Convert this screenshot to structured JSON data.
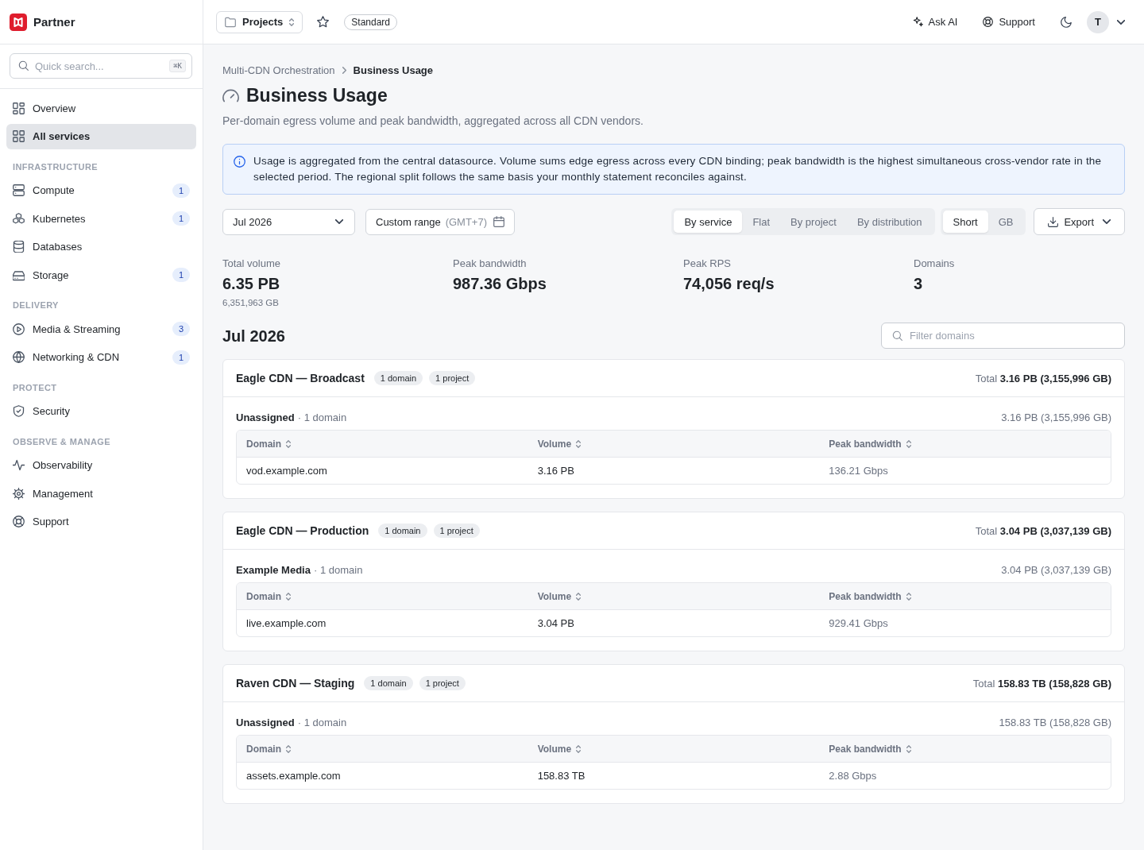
{
  "sidebar": {
    "brand": "Partner",
    "search": {
      "placeholder": "Quick search...",
      "shortcut": "⌘K"
    },
    "nav": [
      {
        "items": [
          {
            "label": "Overview",
            "selected": false
          },
          {
            "label": "All services",
            "selected": true
          }
        ]
      },
      {
        "title": "INFRASTRUCTURE",
        "items": [
          {
            "label": "Compute",
            "badge": "1",
            "selected": false
          },
          {
            "label": "Kubernetes",
            "badge": "1",
            "selected": false
          },
          {
            "label": "Databases",
            "selected": false
          },
          {
            "label": "Storage",
            "badge": "1",
            "selected": false
          }
        ]
      },
      {
        "title": "DELIVERY",
        "items": [
          {
            "label": "Media & Streaming",
            "badge": "3",
            "selected": false
          },
          {
            "label": "Networking & CDN",
            "badge": "1",
            "selected": false
          }
        ]
      },
      {
        "title": "PROTECT",
        "items": [
          {
            "label": "Security",
            "selected": false
          }
        ]
      },
      {
        "title": "OBSERVE & MANAGE",
        "items": [
          {
            "label": "Observability",
            "selected": false
          },
          {
            "label": "Management",
            "selected": false
          },
          {
            "label": "Support",
            "selected": false
          }
        ]
      }
    ]
  },
  "topbar": {
    "projects": "Projects",
    "plan": "Standard",
    "actions": [
      "Ask AI",
      "Support"
    ],
    "avatar": "T"
  },
  "breadcrumb": [
    "Multi-CDN Orchestration",
    "Business Usage"
  ],
  "title": "Business Usage",
  "subtitle": "Per-domain egress volume and peak bandwidth, aggregated across all CDN vendors.",
  "notice": "Usage is aggregated from the central datasource. Volume sums edge egress across every CDN binding; peak bandwidth is the highest simultaneous cross-vendor rate in the selected period. The regional split follows the same basis your monthly statement reconciles against.",
  "filters": {
    "month": "Jul 2026",
    "range": {
      "label": "Custom range",
      "timezone": "(GMT+7)"
    },
    "views": [
      {
        "label": "By service",
        "selected": true
      },
      {
        "label": "Flat",
        "selected": false
      },
      {
        "label": "By project",
        "selected": false
      },
      {
        "label": "By distribution",
        "selected": false
      }
    ],
    "units": [
      {
        "label": "Short",
        "selected": true
      },
      {
        "label": "GB",
        "selected": false
      }
    ],
    "export": "Export"
  },
  "stats": [
    {
      "label": "Total volume",
      "value": "6.35 PB",
      "sub": "6,351,963 GB"
    },
    {
      "label": "Peak bandwidth",
      "value": "987.36 Gbps"
    },
    {
      "label": "Peak RPS",
      "value": "74,056 req/s"
    },
    {
      "label": "Domains",
      "value": "3"
    }
  ],
  "period": "Jul 2026",
  "domain_filter": {
    "placeholder": "Filter domains"
  },
  "groups": [
    {
      "name": "Eagle CDN — Broadcast",
      "tags": [
        "1 domain",
        "1 project"
      ],
      "total": "Total **3.16 PB (3,155,996 GB)**",
      "projects": [
        {
          "name": "Unassigned",
          "count": "· 1 domain",
          "total": "3.16 PB (3,155,996 GB)",
          "columns": [
            "Domain",
            "Volume",
            "Peak bandwidth"
          ],
          "rows": [
            {
              "domain": "vod.example.com",
              "volume": "3.16 PB",
              "peak": "136.21 Gbps"
            }
          ]
        }
      ]
    },
    {
      "name": "Eagle CDN — Production",
      "tags": [
        "1 domain",
        "1 project"
      ],
      "total": "Total **3.04 PB (3,037,139 GB)**",
      "projects": [
        {
          "name": "Example Media",
          "count": "· 1 domain",
          "total": "3.04 PB (3,037,139 GB)",
          "columns": [
            "Domain",
            "Volume",
            "Peak bandwidth"
          ],
          "rows": [
            {
              "domain": "live.example.com",
              "volume": "3.04 PB",
              "peak": "929.41 Gbps"
            }
          ]
        }
      ]
    },
    {
      "name": "Raven CDN — Staging",
      "tags": [
        "1 domain",
        "1 project"
      ],
      "total": "Total **158.83 TB (158,828 GB)**",
      "projects": [
        {
          "name": "Unassigned",
          "count": "· 1 domain",
          "total": "158.83 TB (158,828 GB)",
          "columns": [
            "Domain",
            "Volume",
            "Peak bandwidth"
          ],
          "rows": [
            {
              "domain": "assets.example.com",
              "volume": "158.83 TB",
              "peak": "2.88 Gbps"
            }
          ]
        }
      ]
    }
  ]
}
